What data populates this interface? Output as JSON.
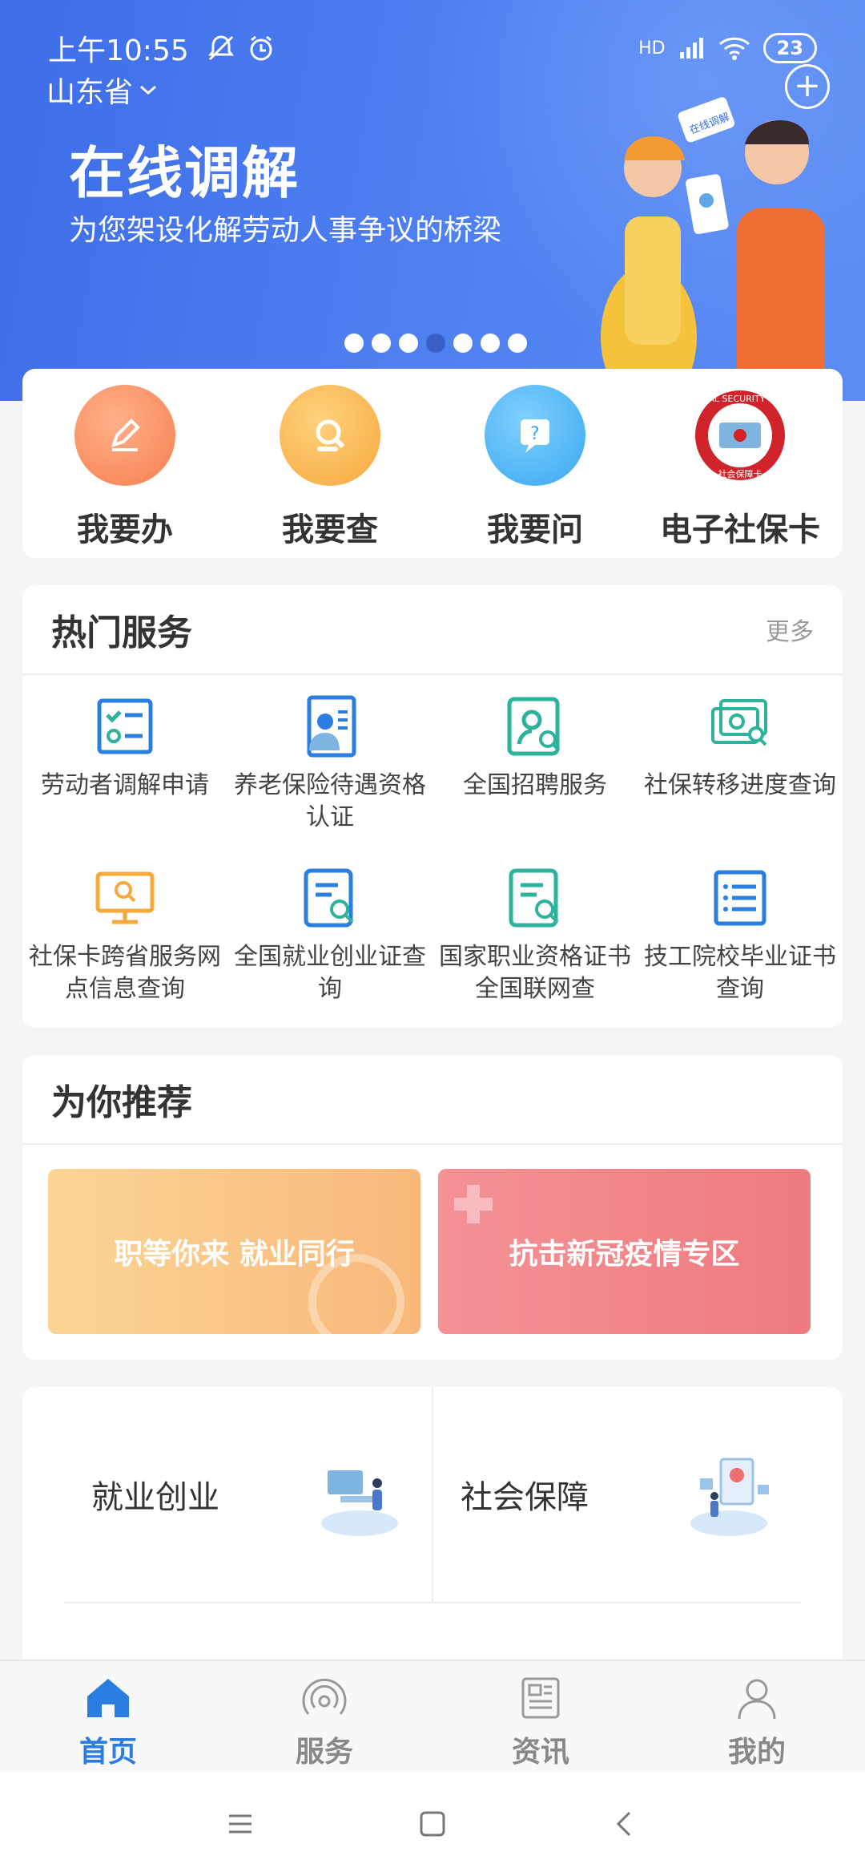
{
  "status_bar": {
    "time": "上午10:55",
    "network": "HD",
    "battery": "23"
  },
  "location": {
    "province": "山东省"
  },
  "banner": {
    "title": "在线调解",
    "subtitle": "为您架设化解劳动人事争议的桥梁",
    "sign_text": "在线调解",
    "dot_count": 7,
    "active_dot": 3
  },
  "quick_actions": [
    {
      "label": "我要办",
      "icon": "pen-icon",
      "color": "#f78d5a"
    },
    {
      "label": "我要查",
      "icon": "magnifier-icon",
      "color": "#f8b04a"
    },
    {
      "label": "我要问",
      "icon": "question-icon",
      "color": "#4cb4f2"
    },
    {
      "label": "电子社保卡",
      "icon": "social-security-card-icon",
      "color": "#d0242a",
      "seal_top": "SOCIAL SECURITY CARD",
      "seal_bottom": "社会保障卡"
    }
  ],
  "hot_services": {
    "title": "热门服务",
    "more": "更多",
    "items": [
      {
        "label": "劳动者调解申请",
        "icon": "checklist-icon"
      },
      {
        "label": "养老保险待遇资格认证",
        "icon": "id-person-icon"
      },
      {
        "label": "全国招聘服务",
        "icon": "profile-search-icon"
      },
      {
        "label": "社保转移进度查询",
        "icon": "transfer-search-icon"
      },
      {
        "label": "社保卡跨省服务网点信息查询",
        "icon": "monitor-search-icon"
      },
      {
        "label": "全国就业创业证查询",
        "icon": "document-search-icon"
      },
      {
        "label": "国家职业资格证书全国联网查",
        "icon": "certificate-search-icon"
      },
      {
        "label": "技工院校毕业证书查询",
        "icon": "list-icon"
      }
    ]
  },
  "recommend": {
    "title": "为你推荐",
    "banners": [
      {
        "label": "职等你来 就业同行"
      },
      {
        "label": "抗击新冠疫情专区"
      }
    ]
  },
  "categories": [
    {
      "label": "就业创业"
    },
    {
      "label": "社会保障"
    }
  ],
  "tabbar": [
    {
      "label": "首页",
      "active": true
    },
    {
      "label": "服务",
      "active": false
    },
    {
      "label": "资讯",
      "active": false
    },
    {
      "label": "我的",
      "active": false
    }
  ],
  "colors": {
    "primary": "#2a7de1",
    "banner": "#4c7ef0",
    "accent_teal": "#2db39b"
  }
}
